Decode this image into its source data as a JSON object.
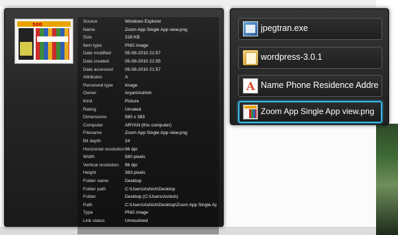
{
  "properties": {
    "rows": [
      {
        "key": "Source",
        "value": "Windows Explorer"
      },
      {
        "key": "Name",
        "value": "Zoom App Single App view.png"
      },
      {
        "key": "Size",
        "value": "228 KB"
      },
      {
        "key": "Item type",
        "value": "PNG image"
      },
      {
        "key": "Date modified",
        "value": "05-08-2010 21:57"
      },
      {
        "key": "Date created",
        "value": "05-08-2010 21:55"
      },
      {
        "key": "Date accessed",
        "value": "05-08-2010 21:57"
      },
      {
        "key": "Attributes",
        "value": "A"
      },
      {
        "key": "Perceived type",
        "value": "Image"
      },
      {
        "key": "Owner",
        "value": "Aryan\\Ashish"
      },
      {
        "key": "Kind",
        "value": "Picture"
      },
      {
        "key": "Rating",
        "value": "Unrated"
      },
      {
        "key": "Dimensions",
        "value": "580 x 383"
      },
      {
        "key": "Computer",
        "value": "ARYAN (this computer)"
      },
      {
        "key": "Filename",
        "value": "Zoom App Single App view.png"
      },
      {
        "key": "Bit depth",
        "value": "24"
      },
      {
        "key": "Horizontal resolution",
        "value": "96 dpi"
      },
      {
        "key": "Width",
        "value": "580 pixels"
      },
      {
        "key": "Vertical resolution",
        "value": "96 dpi"
      },
      {
        "key": "Height",
        "value": "383 pixels"
      },
      {
        "key": "Folder name",
        "value": "Desktop"
      },
      {
        "key": "Folder path",
        "value": "C:\\Users\\Ashish\\Desktop"
      },
      {
        "key": "Folder",
        "value": "Desktop (C:\\Users\\Ashish)"
      },
      {
        "key": "Path",
        "value": "C:\\Users\\Ashish\\Desktop\\Zoom App Single Ap"
      },
      {
        "key": "Type",
        "value": "PNG image"
      },
      {
        "key": "Link status",
        "value": "Unresolved"
      }
    ],
    "thumbnail": {
      "headline": "500"
    }
  },
  "taskbar_list": {
    "items": [
      {
        "label": "jpegtran.exe",
        "icon": "exe-icon",
        "selected": false
      },
      {
        "label": "wordpress-3.0.1",
        "icon": "folder-icon",
        "selected": false
      },
      {
        "label": "Name Phone Residence Addre ..",
        "icon": "document-icon",
        "selected": false
      },
      {
        "label": "Zoom App Single App view.png",
        "icon": "png-image-icon",
        "selected": true
      }
    ]
  },
  "colors": {
    "selection_border": "#38b6e8",
    "panel_bg": "#262626"
  }
}
